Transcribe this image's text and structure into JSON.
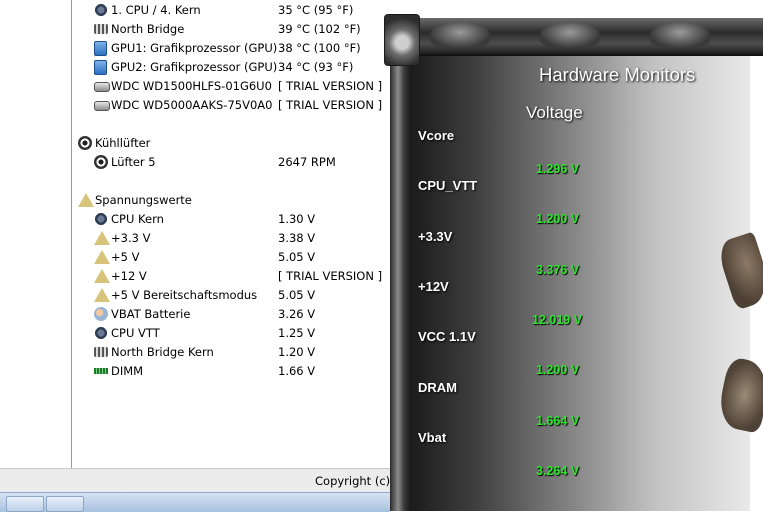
{
  "sensors": [
    {
      "icon": "cpu-icon",
      "name": "1. CPU / 4. Kern",
      "value": "35 °C  (95 °F)",
      "indent": 1
    },
    {
      "icon": "chipset-icon",
      "name": "North Bridge",
      "value": "39 °C  (102 °F)",
      "indent": 1
    },
    {
      "icon": "gpu-icon",
      "name": "GPU1: Grafikprozessor (GPU)",
      "value": "38 °C  (100 °F)",
      "indent": 1
    },
    {
      "icon": "gpu-icon",
      "name": "GPU2: Grafikprozessor (GPU)",
      "value": "34 °C  (93 °F)",
      "indent": 1
    },
    {
      "icon": "hdd-icon",
      "name": "WDC WD1500HLFS-01G6U0",
      "value": "[ TRIAL VERSION ]",
      "indent": 1
    },
    {
      "icon": "hdd-icon",
      "name": "WDC WD5000AAKS-75V0A0",
      "value": "[ TRIAL VERSION ]",
      "indent": 1
    },
    {
      "icon": "fan-icon",
      "name": "Kühllüfter",
      "value": "",
      "indent": 0
    },
    {
      "icon": "fan-icon",
      "name": "Lüfter 5",
      "value": "2647 RPM",
      "indent": 1
    },
    {
      "icon": "voltage-icon",
      "name": "Spannungswerte",
      "value": "",
      "indent": 0
    },
    {
      "icon": "cpu-icon",
      "name": "CPU Kern",
      "value": "1.30 V",
      "indent": 1
    },
    {
      "icon": "voltage-icon",
      "name": "+3.3 V",
      "value": "3.38 V",
      "indent": 1
    },
    {
      "icon": "voltage-icon",
      "name": "+5 V",
      "value": "5.05 V",
      "indent": 1
    },
    {
      "icon": "voltage-icon",
      "name": "+12 V",
      "value": "[ TRIAL VERSION ]",
      "indent": 1
    },
    {
      "icon": "voltage-icon",
      "name": "+5 V Bereitschaftsmodus",
      "value": "5.05 V",
      "indent": 1
    },
    {
      "icon": "battery-icon",
      "name": "VBAT Batterie",
      "value": "3.26 V",
      "indent": 1
    },
    {
      "icon": "cpu-icon",
      "name": "CPU VTT",
      "value": "1.25 V",
      "indent": 1
    },
    {
      "icon": "chipset-icon",
      "name": "North Bridge Kern",
      "value": "1.20 V",
      "indent": 1
    },
    {
      "icon": "memory-icon",
      "name": "DIMM",
      "value": "1.66 V",
      "indent": 1
    }
  ],
  "statusbar": {
    "text": "Copyright (c) ."
  },
  "gadget": {
    "title": "Hardware Monitors",
    "subtitle": "Voltage",
    "readings": [
      {
        "label": "Vcore",
        "value": "1.296 V"
      },
      {
        "label": "CPU_VTT",
        "value": "1.200 V"
      },
      {
        "label": "+3.3V",
        "value": "3.376 V"
      },
      {
        "label": "+12V",
        "value": "12.019 V"
      },
      {
        "label": "VCC 1.1V",
        "value": "1.200 V"
      },
      {
        "label": "DRAM",
        "value": "1.664 V"
      },
      {
        "label": "Vbat",
        "value": "3.264 V"
      }
    ]
  },
  "colors": {
    "value_green": "#2fe32f",
    "panel_light": "#e9e9e9",
    "panel_dark": "#1b1b1b"
  }
}
